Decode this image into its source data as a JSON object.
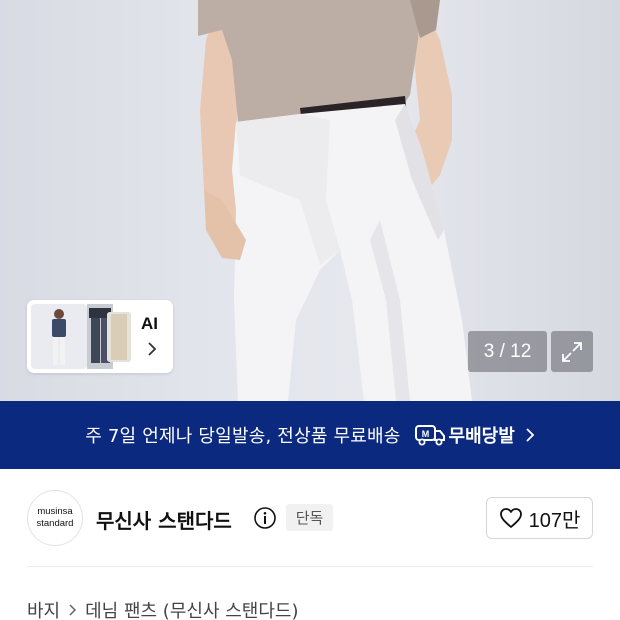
{
  "gallery": {
    "counter": "3 / 12",
    "ai_label": "AI",
    "icons": {
      "expand": "expand-icon",
      "ai_chevron": "chevron-right-icon"
    }
  },
  "delivery_banner": {
    "text": "주 7일 언제나 당일발송, 전상품 무료배송",
    "badge_label": "무배당발",
    "badge_icon": "delivery-truck-icon",
    "color": "#0b2a7f"
  },
  "brand": {
    "logo_line1": "musinsa",
    "logo_line2": "standard",
    "name": "무신사 스탠다드",
    "badge": "단독",
    "likes": "107만",
    "icons": {
      "info": "info-icon",
      "like": "heart-icon"
    }
  },
  "breadcrumb": {
    "items": [
      "바지",
      "데님 팬츠 (무신사 스탠다드)"
    ]
  }
}
